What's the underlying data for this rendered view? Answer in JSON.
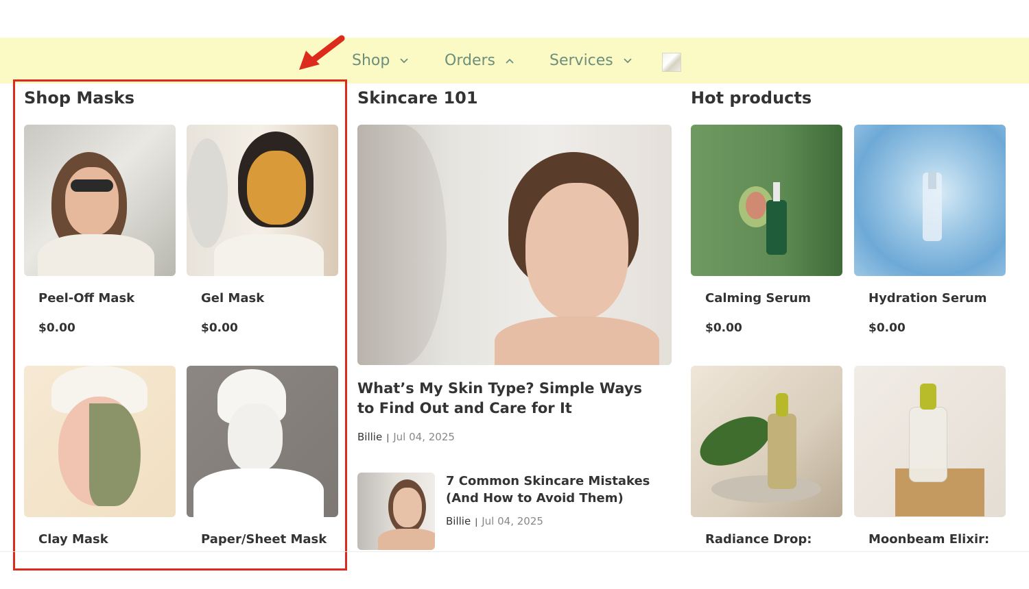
{
  "nav": {
    "items": [
      {
        "label": "Shop",
        "chevron": "chevron-down-icon"
      },
      {
        "label": "Orders",
        "chevron": "chevron-up-icon"
      },
      {
        "label": "Services",
        "chevron": "chevron-down-icon"
      }
    ],
    "background": "#fcfac4",
    "text_color": "#6b8f7b"
  },
  "shop_masks": {
    "title": "Shop Masks",
    "products": [
      {
        "name": "Peel-Off Mask",
        "price": "$0.00"
      },
      {
        "name": "Gel Mask",
        "price": "$0.00"
      },
      {
        "name": "Clay Mask"
      },
      {
        "name": "Paper/Sheet Mask"
      }
    ]
  },
  "skincare": {
    "title": "Skincare 101",
    "featured": {
      "title": "What’s My Skin Type? Simple Ways to Find Out and Care for It",
      "author": "Billie",
      "date": "Jul 04, 2025"
    },
    "posts": [
      {
        "title": "7 Common Skincare Mistakes (And How to Avoid Them)",
        "author": "Billie",
        "date": "Jul 04, 2025"
      }
    ]
  },
  "hot_products": {
    "title": "Hot products",
    "products": [
      {
        "name": "Calming Serum",
        "price": "$0.00"
      },
      {
        "name": "Hydration Serum",
        "price": "$0.00"
      },
      {
        "name": "Radiance Drop:"
      },
      {
        "name": "Moonbeam Elixir:"
      }
    ]
  },
  "annotation": {
    "color": "#dc2a1c"
  }
}
